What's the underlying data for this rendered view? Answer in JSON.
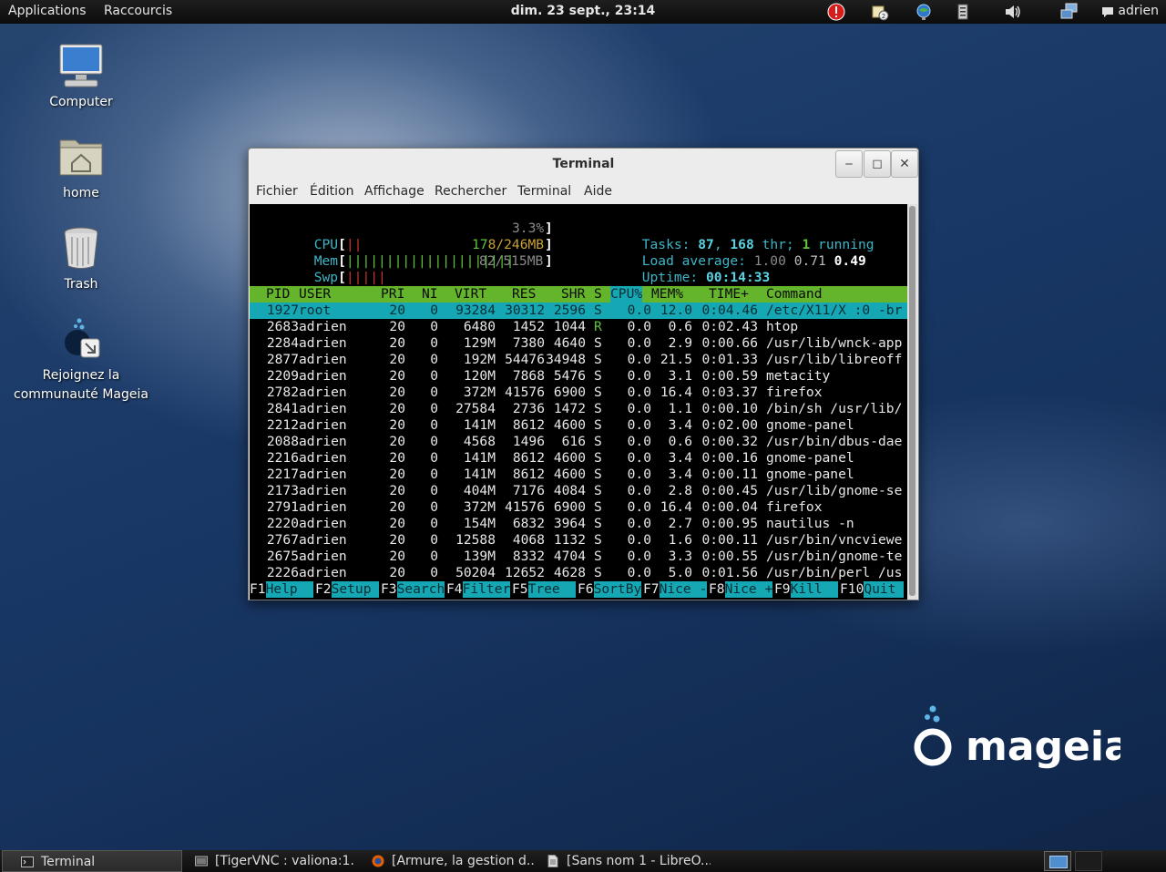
{
  "top_panel": {
    "applications": "Applications",
    "shortcuts": "Raccourcis",
    "clock": "dim. 23 sept., 23:14",
    "user": "adrien",
    "tray_icons": [
      "alert-icon",
      "updates-icon",
      "network-globe-icon",
      "clipboard-icon",
      "volume-icon",
      "network-icon",
      "chat-icon"
    ]
  },
  "desktop": {
    "icons": [
      {
        "label": "Computer"
      },
      {
        "label": "home"
      },
      {
        "label": "Trash"
      },
      {
        "label1": "Rejoignez la",
        "label2": "communauté Mageia"
      }
    ],
    "logo_text": "mageia"
  },
  "terminal": {
    "title": "Terminal",
    "buttons": {
      "minimize": "‒",
      "maximize": "◻",
      "close": "✕"
    },
    "menu": [
      "Fichier",
      "Édition",
      "Affichage",
      "Rechercher",
      "Terminal",
      "Aide"
    ],
    "meters": {
      "cpu": {
        "label": "CPU",
        "bar": "||",
        "value": "3.3%"
      },
      "mem": {
        "label": "Mem",
        "bar": "|||||||||||||||||||||",
        "value_a": "17",
        "value_b": "8/246MB"
      },
      "swp": {
        "label": "Swp",
        "bar": "|||||",
        "value": "82/515MB"
      }
    },
    "summary": {
      "tasks_label": "Tasks: ",
      "tasks": "87",
      "thr_sep": ", ",
      "thr": "168",
      "thr_label": " thr; ",
      "running": "1",
      "running_label": " running",
      "load_label": "Load average: ",
      "load1": "1.00",
      "load5": "0.71",
      "load15": "0.49",
      "uptime_label": "Uptime: ",
      "uptime": "00:14:33"
    },
    "columns": [
      "PID",
      "USER",
      "PRI",
      "NI",
      "VIRT",
      "RES",
      "SHR",
      "S",
      "CPU%",
      "MEM%",
      "TIME+",
      "Command"
    ],
    "processes": [
      [
        "1927",
        "root",
        "20",
        "0",
        "93284",
        "30312",
        "2596",
        "S",
        "0.0",
        "12.0",
        "0:04.46",
        "/etc/X11/X :0 -br"
      ],
      [
        "2683",
        "adrien",
        "20",
        "0",
        "6480",
        "1452",
        "1044",
        "R",
        "0.0",
        "0.6",
        "0:02.43",
        "htop"
      ],
      [
        "2284",
        "adrien",
        "20",
        "0",
        "129M",
        "7380",
        "4640",
        "S",
        "0.0",
        "2.9",
        "0:00.66",
        "/usr/lib/wnck-app"
      ],
      [
        "2877",
        "adrien",
        "20",
        "0",
        "192M",
        "54476",
        "34948",
        "S",
        "0.0",
        "21.5",
        "0:01.33",
        "/usr/lib/libreoff"
      ],
      [
        "2209",
        "adrien",
        "20",
        "0",
        "120M",
        "7868",
        "5476",
        "S",
        "0.0",
        "3.1",
        "0:00.59",
        "metacity"
      ],
      [
        "2782",
        "adrien",
        "20",
        "0",
        "372M",
        "41576",
        "6900",
        "S",
        "0.0",
        "16.4",
        "0:03.37",
        "firefox"
      ],
      [
        "2841",
        "adrien",
        "20",
        "0",
        "27584",
        "2736",
        "1472",
        "S",
        "0.0",
        "1.1",
        "0:00.10",
        "/bin/sh /usr/lib/"
      ],
      [
        "2212",
        "adrien",
        "20",
        "0",
        "141M",
        "8612",
        "4600",
        "S",
        "0.0",
        "3.4",
        "0:02.00",
        "gnome-panel"
      ],
      [
        "2088",
        "adrien",
        "20",
        "0",
        "4568",
        "1496",
        "616",
        "S",
        "0.0",
        "0.6",
        "0:00.32",
        "/usr/bin/dbus-dae"
      ],
      [
        "2216",
        "adrien",
        "20",
        "0",
        "141M",
        "8612",
        "4600",
        "S",
        "0.0",
        "3.4",
        "0:00.16",
        "gnome-panel"
      ],
      [
        "2217",
        "adrien",
        "20",
        "0",
        "141M",
        "8612",
        "4600",
        "S",
        "0.0",
        "3.4",
        "0:00.11",
        "gnome-panel"
      ],
      [
        "2173",
        "adrien",
        "20",
        "0",
        "404M",
        "7176",
        "4084",
        "S",
        "0.0",
        "2.8",
        "0:00.45",
        "/usr/lib/gnome-se"
      ],
      [
        "2791",
        "adrien",
        "20",
        "0",
        "372M",
        "41576",
        "6900",
        "S",
        "0.0",
        "16.4",
        "0:00.04",
        "firefox"
      ],
      [
        "2220",
        "adrien",
        "20",
        "0",
        "154M",
        "6832",
        "3964",
        "S",
        "0.0",
        "2.7",
        "0:00.95",
        "nautilus -n"
      ],
      [
        "2767",
        "adrien",
        "20",
        "0",
        "12588",
        "4068",
        "1132",
        "S",
        "0.0",
        "1.6",
        "0:00.11",
        "/usr/bin/vncviewe"
      ],
      [
        "2675",
        "adrien",
        "20",
        "0",
        "139M",
        "8332",
        "4704",
        "S",
        "0.0",
        "3.3",
        "0:00.55",
        "/usr/bin/gnome-te"
      ],
      [
        "2226",
        "adrien",
        "20",
        "0",
        "50204",
        "12652",
        "4628",
        "S",
        "0.0",
        "5.0",
        "0:01.56",
        "/usr/bin/perl /us"
      ]
    ],
    "fkeys": [
      {
        "key": "F1",
        "label": "Help  "
      },
      {
        "key": "F2",
        "label": "Setup "
      },
      {
        "key": "F3",
        "label": "Search"
      },
      {
        "key": "F4",
        "label": "Filter"
      },
      {
        "key": "F5",
        "label": "Tree  "
      },
      {
        "key": "F6",
        "label": "SortBy"
      },
      {
        "key": "F7",
        "label": "Nice -"
      },
      {
        "key": "F8",
        "label": "Nice +"
      },
      {
        "key": "F9",
        "label": "Kill  "
      },
      {
        "key": "F10",
        "label": "Quit "
      }
    ]
  },
  "taskbar": {
    "items": [
      {
        "label": "Terminal",
        "icon": "terminal-icon"
      },
      {
        "label": "[TigerVNC : valiona:1...",
        "icon": "vnc-icon"
      },
      {
        "label": "[Armure, la gestion d...",
        "icon": "firefox-icon"
      },
      {
        "label": "[Sans nom 1 - LibreO...",
        "icon": "document-icon"
      }
    ]
  }
}
